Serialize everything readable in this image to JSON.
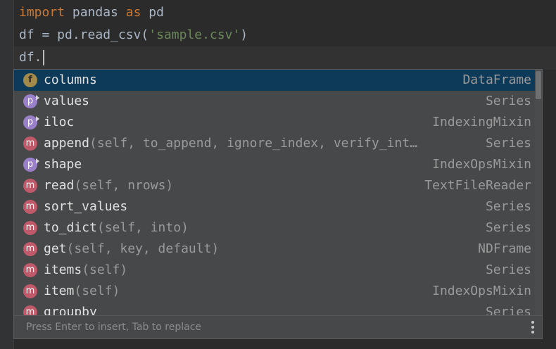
{
  "editor": {
    "line1": {
      "kw1": "import",
      "t1": " pandas ",
      "kw2": "as",
      "t2": " pd"
    },
    "line2": {
      "t1": "df = pd.read_csv(",
      "str": "'sample.csv'",
      "t2": ")"
    },
    "line3": {
      "t1": "df."
    }
  },
  "completion": {
    "items": [
      {
        "kind": "f",
        "name": "columns",
        "params": "",
        "type": "DataFrame",
        "selected": true
      },
      {
        "kind": "p",
        "name": "values",
        "params": "",
        "type": "Series"
      },
      {
        "kind": "p",
        "name": "iloc",
        "params": "",
        "type": "IndexingMixin"
      },
      {
        "kind": "m",
        "name": "append",
        "params": "(self, to_append, ignore_index, verify_int…",
        "type": "Series"
      },
      {
        "kind": "p",
        "name": "shape",
        "params": "",
        "type": "IndexOpsMixin"
      },
      {
        "kind": "m",
        "name": "read",
        "params": "(self, nrows)",
        "type": "TextFileReader"
      },
      {
        "kind": "m",
        "name": "sort_values",
        "params": "",
        "type": "Series"
      },
      {
        "kind": "m",
        "name": "to_dict",
        "params": "(self, into)",
        "type": "Series"
      },
      {
        "kind": "m",
        "name": "get",
        "params": "(self, key, default)",
        "type": "NDFrame"
      },
      {
        "kind": "m",
        "name": "items",
        "params": "(self)",
        "type": "Series"
      },
      {
        "kind": "m",
        "name": "item",
        "params": "(self)",
        "type": "IndexOpsMixin"
      },
      {
        "kind": "m",
        "name": "groupby",
        "params": "",
        "type": "Series"
      }
    ],
    "footer_hint": "Press Enter to insert, Tab to replace"
  }
}
